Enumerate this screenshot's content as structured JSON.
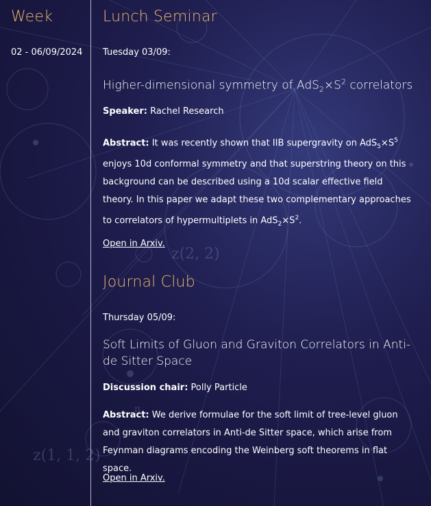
{
  "sidebar": {
    "heading": "Week",
    "date_range": "02 - 06/09/2024"
  },
  "background": {
    "math_label_1": "z(2, 2)",
    "math_label_2": "z(1, 1, 2)",
    "math_label_3": "π"
  },
  "lunch_seminar": {
    "section_title": "Lunch Seminar",
    "date": "Tuesday 03/09:",
    "title_pre": "Higher-dimensional symmetry of AdS",
    "title_sub": "2",
    "title_mid": "×S",
    "title_sup": "2",
    "title_post": " correlators",
    "speaker_label": "Speaker:",
    "speaker_name": " Rachel Research",
    "abstract_label": "Abstract:",
    "abstract_part1": " It was recently shown that IIB supergravity on AdS",
    "abstract_sub1": "5",
    "abstract_mid1": "×S",
    "abstract_sup1": "5",
    "abstract_part2": " enjoys 10d conformal symmetry and that superstring theory on this background can be described using a 10d scalar effective field theory. In this paper we adapt these two complementary approaches to correlators of hypermultiplets in AdS",
    "abstract_sub2": "2",
    "abstract_mid2": "×S",
    "abstract_sup2": "2",
    "abstract_end": ".",
    "link": "Open in Arxiv."
  },
  "journal_club": {
    "section_title": "Journal Club",
    "date": "Thursday 05/09:",
    "title": "Soft Limits of Gluon and Graviton Correlators in Anti-de Sitter Space",
    "chair_label": "Discussion chair:",
    "chair_name": " Polly Particle",
    "abstract_label": "Abstract:",
    "abstract_text": " We derive formulae for the soft limit of tree-level gluon and graviton correlators in Anti-de Sitter space, which arise from Feynman diagrams encoding the Weinberg soft theorems in flat space.",
    "link": "Open in Arxiv."
  }
}
